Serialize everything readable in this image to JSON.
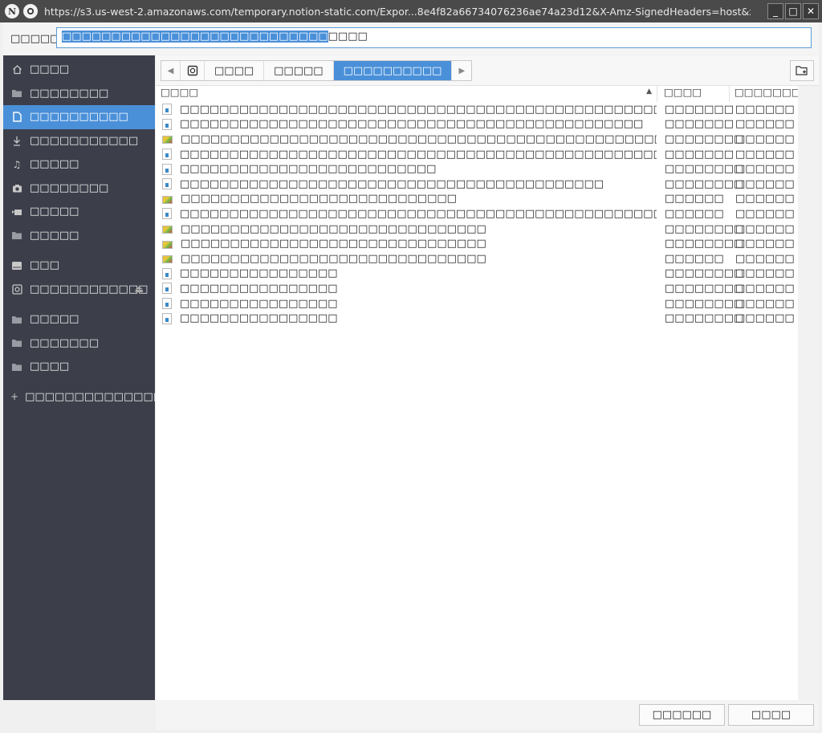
{
  "window": {
    "title": "https://s3.us-west-2.amazonaws.com/temporary.notion-static.com/Expor...8e4f82a66734076236ae74a23d12&X-Amz-SignedHeaders=host&x-id=GetObject",
    "app_icon": "N",
    "minimize": "_",
    "maximize": "□",
    "close": "✕"
  },
  "name_field": {
    "label": "□□□□□",
    "selected_text": "□□□□□□□□□□□□□□□□□□□□□□□□□□□",
    "unselected_text": "□□□□"
  },
  "sidebar": {
    "items": [
      {
        "label": "□□□□",
        "icon": "home-icon"
      },
      {
        "label": "□□□□□□□□",
        "icon": "folder-icon"
      },
      {
        "label": "□□□□□□□□□□",
        "icon": "document-icon",
        "active": true
      },
      {
        "label": "□□□□□□□□□□□",
        "icon": "download-icon"
      },
      {
        "label": "□□□□□",
        "icon": "music-icon"
      },
      {
        "label": "□□□□□□□□",
        "icon": "camera-icon"
      },
      {
        "label": "□□□□□",
        "icon": "video-icon"
      },
      {
        "label": "□□□□□",
        "icon": "folder-icon"
      },
      {
        "label": "□□□",
        "icon": "drive-icon"
      },
      {
        "label": "□□□□□□□□□□□□",
        "icon": "disk-icon",
        "eject": true
      },
      {
        "label": "□□□□□",
        "icon": "folder-icon"
      },
      {
        "label": "□□□□□□□",
        "icon": "folder-icon"
      },
      {
        "label": "□□□□",
        "icon": "folder-icon"
      },
      {
        "label": "□□□□□□□□□□□□□□□",
        "icon": "plus-icon"
      }
    ]
  },
  "pathbar": {
    "crumbs": [
      "□□□□",
      "□□□□□",
      "□□□□□□□□□□"
    ]
  },
  "columns": {
    "name": "□□□□",
    "size": "□□□□",
    "modified": "□□□□□□□□"
  },
  "files": [
    {
      "name": "□□□□□□□□□□□□□□□□□□□□□□□□□□□□□□□□□□□□□□□□□□□□□□□□□□□□□□□□□□",
      "type": "doc",
      "size": "□□□□□□□",
      "modified": "□□□□□□"
    },
    {
      "name": "□□□□□□□□□□□□□□□□□□□□□□□□□□□□□□□□□□□□□□□□□□□□□□□",
      "type": "doc",
      "size": "□□□□□□□",
      "modified": "□□□□□□"
    },
    {
      "name": "□□□□□□□□□□□□□□□□□□□□□□□□□□□□□□□□□□□□□□□□□□□□□□□□□□",
      "type": "img",
      "size": "□□□□□□□□",
      "modified": "□□□□□□"
    },
    {
      "name": "□□□□□□□□□□□□□□□□□□□□□□□□□□□□□□□□□□□□□□□□□□□□□□□□□□□□□□□□□□□□□□□□□□",
      "type": "doc",
      "size": "□□□□□□□",
      "modified": "□□□□□□"
    },
    {
      "name": "□□□□□□□□□□□□□□□□□□□□□□□□□□",
      "type": "doc",
      "size": "□□□□□□□□",
      "modified": "□□□□□□"
    },
    {
      "name": "□□□□□□□□□□□□□□□□□□□□□□□□□□□□□□□□□□□□□□□□□□□",
      "type": "doc",
      "size": "□□□□□□□□",
      "modified": "□□□□□□"
    },
    {
      "name": "□□□□□□□□□□□□□□□□□□□□□□□□□□□□",
      "type": "img",
      "size": "□□□□□□",
      "modified": "□□□□□□"
    },
    {
      "name": "□□□□□□□□□□□□□□□□□□□□□□□□□□□□□□□□□□□□□□□□□□□□□□□□□□□□□□□",
      "type": "doc",
      "size": "□□□□□□",
      "modified": "□□□□□□"
    },
    {
      "name": "□□□□□□□□□□□□□□□□□□□□□□□□□□□□□□□",
      "type": "img",
      "size": "□□□□□□□□",
      "modified": "□□□□□□"
    },
    {
      "name": "□□□□□□□□□□□□□□□□□□□□□□□□□□□□□□□",
      "type": "img",
      "size": "□□□□□□□□",
      "modified": "□□□□□□"
    },
    {
      "name": "□□□□□□□□□□□□□□□□□□□□□□□□□□□□□□□",
      "type": "img",
      "size": "□□□□□□",
      "modified": "□□□□□□"
    },
    {
      "name": "□□□□□□□□□□□□□□□□",
      "type": "doc",
      "size": "□□□□□□□□",
      "modified": "□□□□□□"
    },
    {
      "name": "□□□□□□□□□□□□□□□□",
      "type": "doc",
      "size": "□□□□□□□□",
      "modified": "□□□□□□"
    },
    {
      "name": "□□□□□□□□□□□□□□□□",
      "type": "doc",
      "size": "□□□□□□□□",
      "modified": "□□□□□□"
    },
    {
      "name": "□□□□□□□□□□□□□□□□",
      "type": "doc",
      "size": "□□□□□□□□",
      "modified": "□□□□□□"
    }
  ],
  "buttons": {
    "cancel": "□□□□□□",
    "save": "□□□□"
  },
  "colors": {
    "accent": "#4a90d9",
    "sidebar_bg": "#3c3f4a",
    "titlebar_bg": "#4a4a4a"
  }
}
